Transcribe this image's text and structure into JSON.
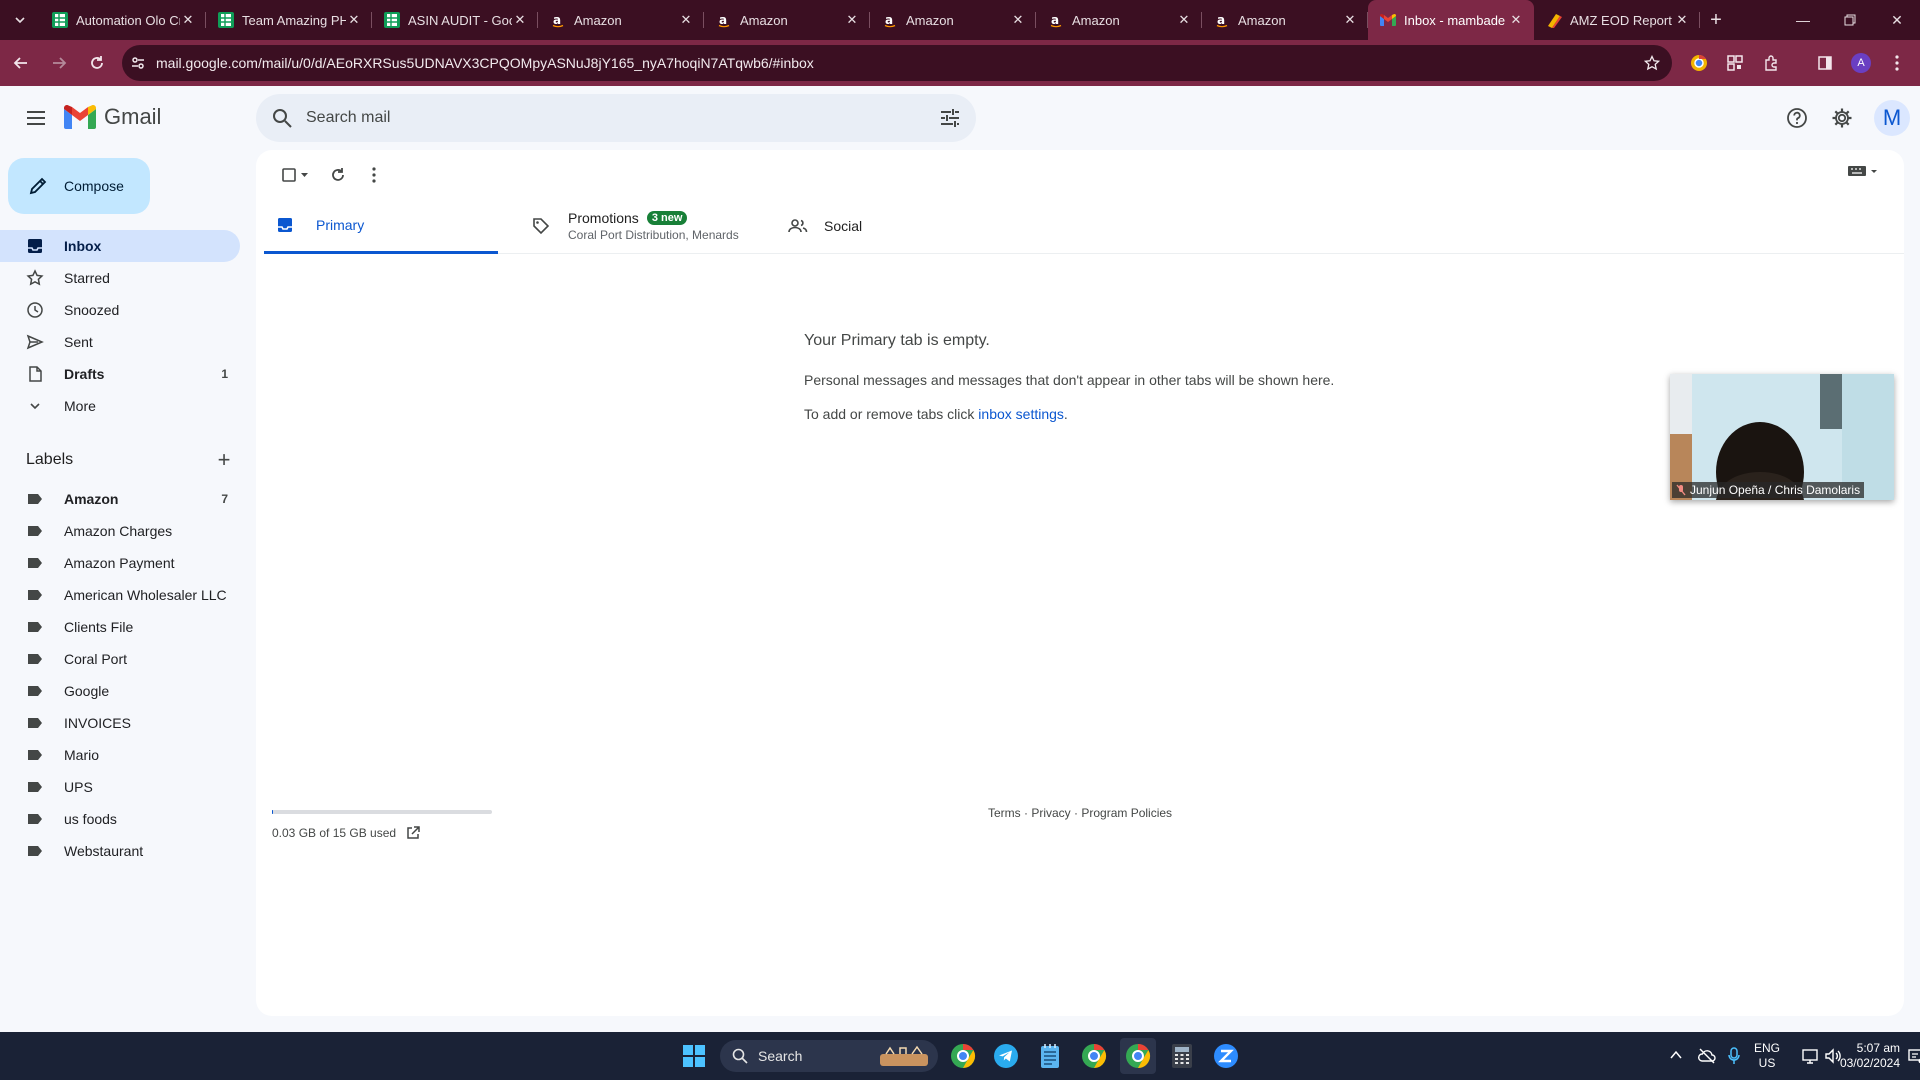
{
  "browser": {
    "tabs": [
      {
        "title": "Automation Olo Cr",
        "favicon": "sheets",
        "active": false
      },
      {
        "title": "Team Amazing PH",
        "favicon": "sheets",
        "active": false
      },
      {
        "title": "ASIN AUDIT - Goo",
        "favicon": "sheets",
        "active": false
      },
      {
        "title": "Amazon",
        "favicon": "amazon",
        "active": false
      },
      {
        "title": "Amazon",
        "favicon": "amazon",
        "active": false
      },
      {
        "title": "Amazon",
        "favicon": "amazon",
        "active": false
      },
      {
        "title": "Amazon",
        "favicon": "amazon",
        "active": false
      },
      {
        "title": "Amazon",
        "favicon": "amazon",
        "active": false
      },
      {
        "title": "Inbox - mambade",
        "favicon": "gmail",
        "active": true
      },
      {
        "title": "AMZ EOD Report",
        "favicon": "eod",
        "active": false
      }
    ],
    "url": "mail.google.com/mail/u/0/d/AEoRXRSus5UDNAVX3CPQOMpyASNuJ8jY165_nyA7hoqiN7ATqwb6/#inbox",
    "profile_initial": "A",
    "colors": {
      "frame": "#3b0f22",
      "toolbar": "#7d2846"
    }
  },
  "gmail": {
    "app_name": "Gmail",
    "search_placeholder": "Search mail",
    "avatar_initial": "M",
    "compose_label": "Compose",
    "nav": [
      {
        "label": "Inbox",
        "count": "",
        "icon": "inbox-icon",
        "active": true
      },
      {
        "label": "Starred",
        "count": "",
        "icon": "star-icon",
        "active": false
      },
      {
        "label": "Snoozed",
        "count": "",
        "icon": "clock-icon",
        "active": false
      },
      {
        "label": "Sent",
        "count": "",
        "icon": "send-icon",
        "active": false
      },
      {
        "label": "Drafts",
        "count": "1",
        "icon": "draft-icon",
        "active": false
      },
      {
        "label": "More",
        "count": "",
        "icon": "chevron-down-icon",
        "active": false
      }
    ],
    "labels_heading": "Labels",
    "labels": [
      {
        "label": "Amazon",
        "count": "7",
        "bold": true
      },
      {
        "label": "Amazon Charges",
        "count": ""
      },
      {
        "label": "Amazon Payment",
        "count": ""
      },
      {
        "label": "American Wholesaler LLC",
        "count": ""
      },
      {
        "label": "Clients File",
        "count": ""
      },
      {
        "label": "Coral Port",
        "count": ""
      },
      {
        "label": "Google",
        "count": ""
      },
      {
        "label": "INVOICES",
        "count": ""
      },
      {
        "label": "Mario",
        "count": ""
      },
      {
        "label": "UPS",
        "count": ""
      },
      {
        "label": "us foods",
        "count": ""
      },
      {
        "label": "Webstaurant",
        "count": ""
      }
    ],
    "inbox_tabs": {
      "primary": "Primary",
      "promotions": "Promotions",
      "promotions_badge": "3 new",
      "promotions_sub": "Coral Port Distribution, Menards",
      "social": "Social"
    },
    "empty_state": {
      "heading": "Your Primary tab is empty.",
      "line1": "Personal messages and messages that don't appear in other tabs will be shown here.",
      "line2_prefix": "To add or remove tabs click ",
      "line2_link": "inbox settings",
      "line2_suffix": "."
    },
    "storage": {
      "text": "0.03 GB of 15 GB used",
      "fraction": 0.002
    },
    "footer": {
      "terms": "Terms",
      "privacy": "Privacy",
      "policies": "Program Policies",
      "sep": " · "
    }
  },
  "video_call": {
    "participant": "Junjun Opeña / Chris Damolaris"
  },
  "taskbar": {
    "search_label": "Search",
    "language": "ENG",
    "region": "US",
    "time": "5:07 am",
    "date": "03/02/2024"
  }
}
